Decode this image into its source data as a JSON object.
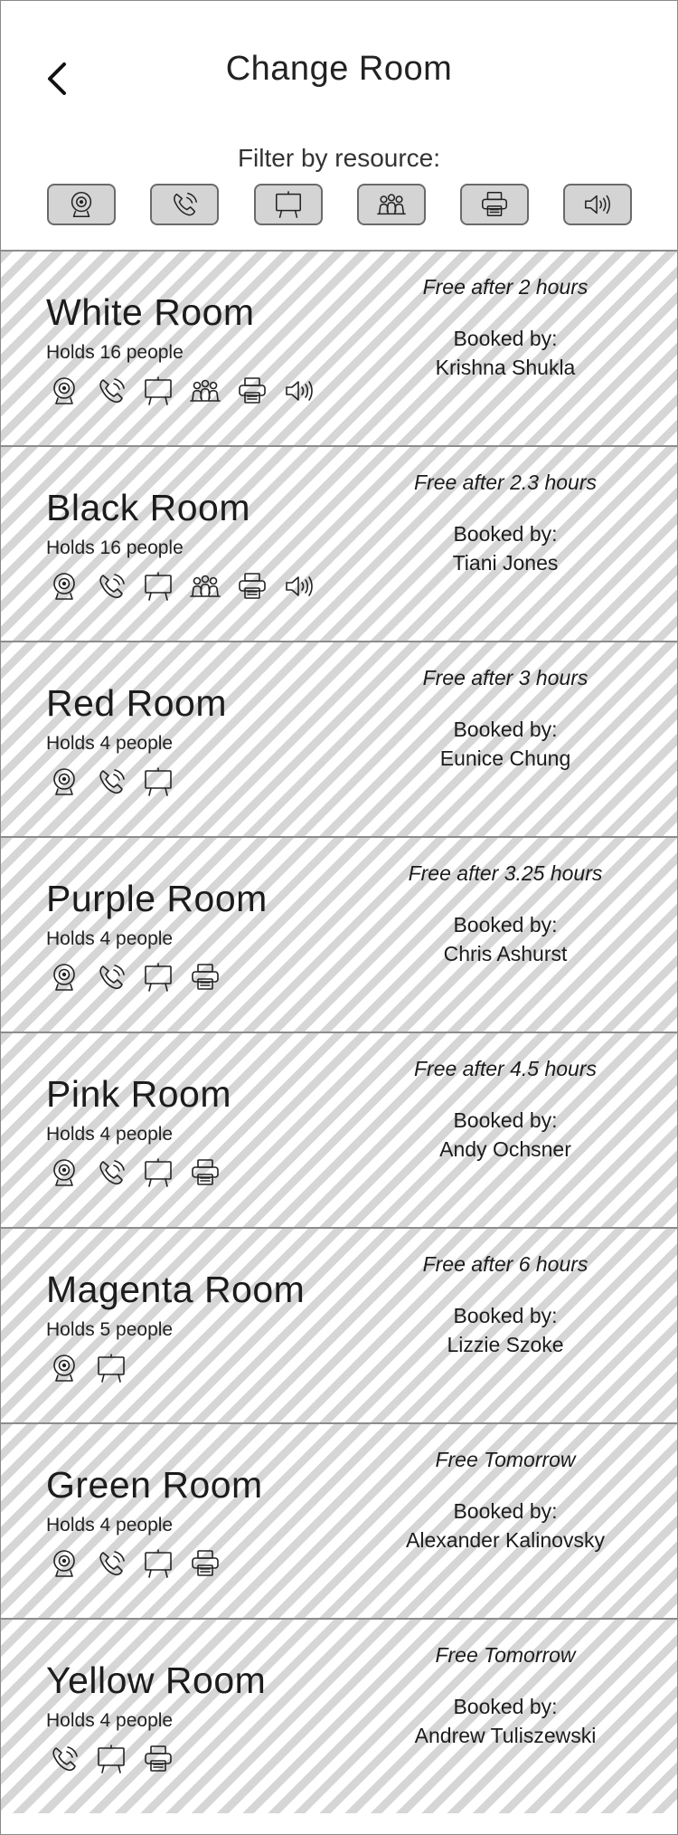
{
  "header": {
    "title": "Change Room",
    "back_icon": "chevron-left-icon",
    "filter_label": "Filter by resource:"
  },
  "filters": [
    {
      "icon": "webcam-icon"
    },
    {
      "icon": "phone-icon"
    },
    {
      "icon": "whiteboard-icon"
    },
    {
      "icon": "people-icon"
    },
    {
      "icon": "printer-icon"
    },
    {
      "icon": "speaker-icon"
    }
  ],
  "booked_label": "Booked by:",
  "rooms": [
    {
      "name": "White Room",
      "capacity": "Holds 16 people",
      "free": "Free after 2 hours",
      "booked_by": "Krishna Shukla",
      "resources": [
        "webcam-icon",
        "phone-icon",
        "whiteboard-icon",
        "people-icon",
        "printer-icon",
        "speaker-icon"
      ]
    },
    {
      "name": "Black Room",
      "capacity": "Holds 16 people",
      "free": "Free after 2.3 hours",
      "booked_by": "Tiani Jones",
      "resources": [
        "webcam-icon",
        "phone-icon",
        "whiteboard-icon",
        "people-icon",
        "printer-icon",
        "speaker-icon"
      ]
    },
    {
      "name": "Red Room",
      "capacity": "Holds 4 people",
      "free": "Free after 3 hours",
      "booked_by": "Eunice Chung",
      "resources": [
        "webcam-icon",
        "phone-icon",
        "whiteboard-icon"
      ]
    },
    {
      "name": "Purple Room",
      "capacity": "Holds 4 people",
      "free": "Free after 3.25 hours",
      "booked_by": "Chris Ashurst",
      "resources": [
        "webcam-icon",
        "phone-icon",
        "whiteboard-icon",
        "printer-icon"
      ]
    },
    {
      "name": "Pink Room",
      "capacity": "Holds 4 people",
      "free": "Free after 4.5 hours",
      "booked_by": "Andy Ochsner",
      "resources": [
        "webcam-icon",
        "phone-icon",
        "whiteboard-icon",
        "printer-icon"
      ]
    },
    {
      "name": "Magenta Room",
      "capacity": "Holds 5 people",
      "free": "Free after 6 hours",
      "booked_by": "Lizzie Szoke",
      "resources": [
        "webcam-icon",
        "whiteboard-icon"
      ]
    },
    {
      "name": "Green Room",
      "capacity": "Holds 4 people",
      "free": "Free Tomorrow",
      "booked_by": "Alexander Kalinovsky",
      "resources": [
        "webcam-icon",
        "phone-icon",
        "whiteboard-icon",
        "printer-icon"
      ]
    },
    {
      "name": "Yellow Room",
      "capacity": "Holds 4 people",
      "free": "Free Tomorrow",
      "booked_by": "Andrew Tuliszewski",
      "resources": [
        "phone-icon",
        "whiteboard-icon",
        "printer-icon"
      ]
    }
  ]
}
